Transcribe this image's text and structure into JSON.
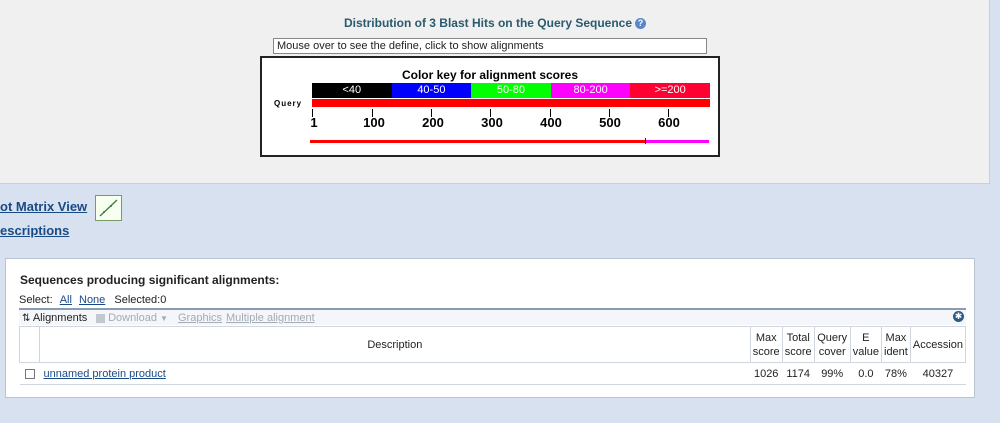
{
  "graphic": {
    "title": "Distribution of 3 Blast Hits on the Query Sequence",
    "help_icon": "?",
    "defline_text": "Mouse over to see the define, click to show alignments",
    "color_key": {
      "title": "Color key for alignment scores",
      "segments": [
        {
          "label": "<40",
          "color": "#000000"
        },
        {
          "label": "40-50",
          "color": "#0000ff"
        },
        {
          "label": "50-80",
          "color": "#00ff00"
        },
        {
          "label": "80-200",
          "color": "#ff00ff"
        },
        {
          "label": ">=200",
          "color": "#ff0033"
        }
      ]
    },
    "query_label": "Query",
    "ticks": [
      "1",
      "100",
      "200",
      "300",
      "400",
      "500",
      "600"
    ],
    "hit_colors": [
      "#ff0000",
      "#ff00ff"
    ]
  },
  "links": {
    "dot_matrix": "ot Matrix View",
    "descriptions": "escriptions"
  },
  "sequences": {
    "title": "Sequences producing significant alignments:",
    "select_label": "Select:",
    "select_all": "All",
    "select_none": "None",
    "selected": "Selected:0",
    "toolbar": {
      "alignments": "Alignments",
      "download": "Download",
      "graphics": "Graphics",
      "multiple_alignment": "Multiple alignment"
    },
    "columns": {
      "description": "Description",
      "max_score": [
        "Max",
        "score"
      ],
      "total_score": [
        "Total",
        "score"
      ],
      "query_cover": [
        "Query",
        "cover"
      ],
      "e_value": [
        "E",
        "value"
      ],
      "max_ident": [
        "Max",
        "ident"
      ],
      "accession": "Accession"
    },
    "rows": [
      {
        "description": "unnamed protein product",
        "max_score": "1026",
        "total_score": "1174",
        "query_cover": "99%",
        "e_value": "0.0",
        "max_ident": "78%",
        "accession": "40327"
      }
    ]
  }
}
